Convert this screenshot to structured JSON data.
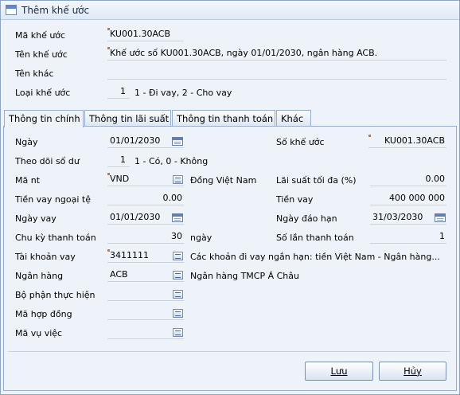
{
  "window": {
    "title": "Thêm khế ước"
  },
  "header": {
    "ma_khe_uoc": {
      "label": "Mã khế ước",
      "value": "KU001.30ACB"
    },
    "ten_khe_uoc": {
      "label": "Tên khế ước",
      "value": "Khế ước số KU001.30ACB, ngày 01/01/2030, ngân hàng ACB."
    },
    "ten_khac": {
      "label": "Tên khác",
      "value": ""
    },
    "loai_khe_uoc": {
      "label": "Loại khế ước",
      "value": "1",
      "hint": "1 - Đi vay, 2 - Cho vay"
    }
  },
  "tabs": [
    {
      "label": "Thông tin chính"
    },
    {
      "label": "Thông tin lãi suất"
    },
    {
      "label": "Thông tin thanh toán"
    },
    {
      "label": "Khác"
    }
  ],
  "main": {
    "ngay": {
      "label": "Ngày",
      "value": "01/01/2030"
    },
    "theo_doi_so_du": {
      "label": "Theo dõi số dư",
      "value": "1",
      "hint": "1 - Có, 0 - Không"
    },
    "ma_nt": {
      "label": "Mã nt",
      "value": "VND",
      "desc": "Đồng Việt Nam"
    },
    "tien_vay_nt": {
      "label": "Tiền vay ngoại tệ",
      "value": "0.00"
    },
    "ngay_vay": {
      "label": "Ngày vay",
      "value": "01/01/2030"
    },
    "chu_ky_tt": {
      "label": "Chu kỳ thanh toán",
      "value": "30",
      "unit": "ngày"
    },
    "tk_vay": {
      "label": "Tài khoản vay",
      "value": "3411111",
      "desc": "Các khoản đi vay ngắn hạn: tiền Việt Nam - Ngân hàng..."
    },
    "ngan_hang": {
      "label": "Ngân hàng",
      "value": "ACB",
      "desc": "Ngân hàng TMCP Á Châu"
    },
    "bo_phan": {
      "label": "Bộ phận thực hiện",
      "value": ""
    },
    "ma_hop_dong": {
      "label": "Mã hợp đồng",
      "value": ""
    },
    "ma_vu_viec": {
      "label": "Mã vụ việc",
      "value": ""
    },
    "so_khe_uoc": {
      "label": "Số khế ước",
      "value": "KU001.30ACB"
    },
    "lai_suat_toi_da": {
      "label": "Lãi suất tối đa (%)",
      "value": "0.00"
    },
    "tien_vay": {
      "label": "Tiền vay",
      "value": "400 000 000"
    },
    "ngay_dao_han": {
      "label": "Ngày đáo hạn",
      "value": "31/03/2030"
    },
    "so_lan_tt": {
      "label": "Số lần thanh toán",
      "value": "1"
    }
  },
  "footer": {
    "save_label": "Lưu",
    "cancel_label": "Hủy"
  }
}
